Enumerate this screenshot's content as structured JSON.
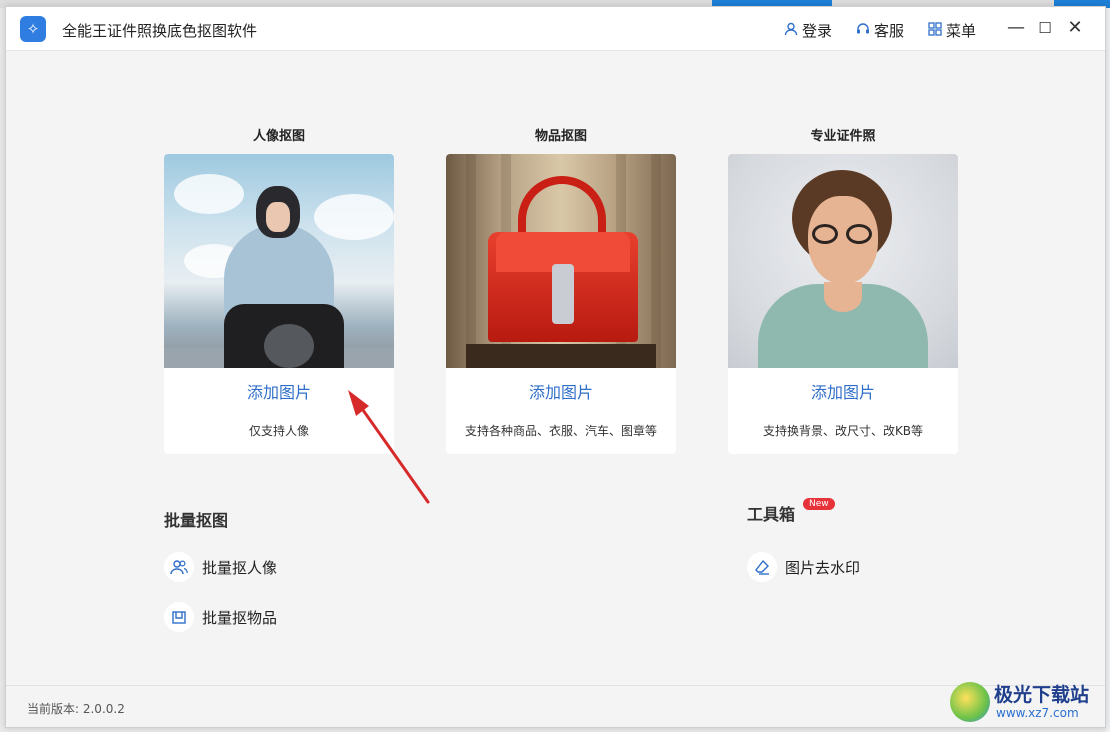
{
  "window": {
    "title": "全能王证件照换底色抠图软件",
    "logo_icon": "app-logo-icon"
  },
  "titlebar": {
    "login_label": "登录",
    "service_label": "客服",
    "menu_label": "菜单",
    "minimize_symbol": "—",
    "maximize_symbol": "☐",
    "close_symbol": "✕"
  },
  "cards": [
    {
      "section_title": "人像抠图",
      "add_label": "添加图片",
      "description": "仅支持人像"
    },
    {
      "section_title": "物品抠图",
      "add_label": "添加图片",
      "description": "支持各种商品、衣服、汽车、图章等"
    },
    {
      "section_title": "专业证件照",
      "add_label": "添加图片",
      "description": "支持换背景、改尺寸、改KB等"
    }
  ],
  "batch": {
    "title": "批量抠图",
    "items": [
      {
        "label": "批量抠人像",
        "icon": "users-icon"
      },
      {
        "label": "批量抠物品",
        "icon": "box-icon"
      }
    ]
  },
  "toolbox": {
    "title": "工具箱",
    "badge": "New",
    "items": [
      {
        "label": "图片去水印",
        "icon": "eraser-icon"
      }
    ]
  },
  "footer": {
    "version_text": "当前版本: 2.0.0.2"
  },
  "watermark": {
    "title": "极光下载站",
    "url": "www.xz7.com"
  },
  "colors": {
    "accent": "#2f6fc9",
    "badge": "#e8323a",
    "arrow": "#d62a2a"
  }
}
